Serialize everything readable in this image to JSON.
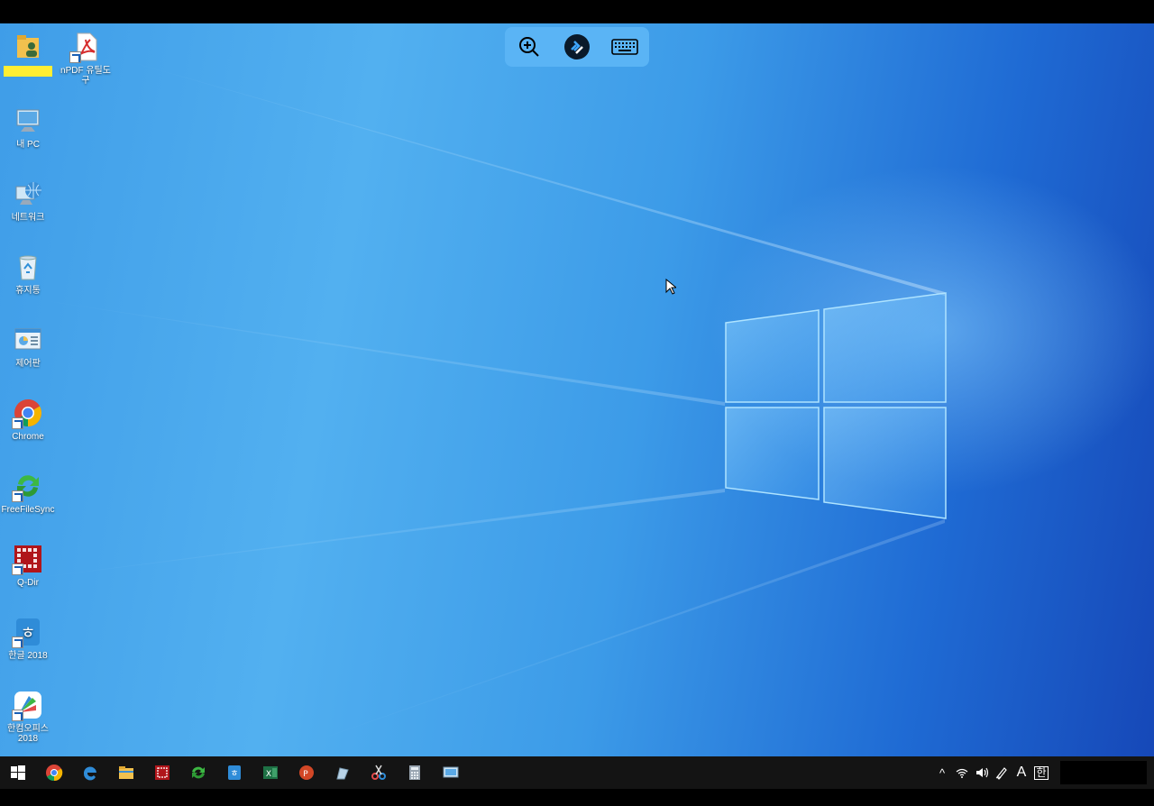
{
  "rdp_toolbar": {
    "zoom_tooltip": "Zoom",
    "connection_tooltip": "Remote Desktop",
    "keyboard_tooltip": "Keyboard"
  },
  "desktop_icons": [
    {
      "name": "user-folder",
      "label": "",
      "icon": "user-folder-icon",
      "highlighted": true
    },
    {
      "name": "npdf",
      "label": "nPDF 유틸도구",
      "icon": "pdf-icon"
    },
    {
      "name": "my-pc",
      "label": "내 PC",
      "icon": "computer-icon"
    },
    {
      "name": "network",
      "label": "네트워크",
      "icon": "network-icon"
    },
    {
      "name": "recycle-bin",
      "label": "휴지통",
      "icon": "recycle-bin-icon"
    },
    {
      "name": "control-panel",
      "label": "제어판",
      "icon": "control-panel-icon"
    },
    {
      "name": "chrome",
      "label": "Chrome",
      "icon": "chrome-icon"
    },
    {
      "name": "freefilesync",
      "label": "FreeFileSync",
      "icon": "sync-icon"
    },
    {
      "name": "q-dir",
      "label": "Q-Dir",
      "icon": "grid-icon"
    },
    {
      "name": "hangul",
      "label": "한글 2018",
      "icon": "hangul-icon"
    },
    {
      "name": "hancom-office",
      "label": "한컴오피스 2018",
      "icon": "hancom-icon"
    }
  ],
  "taskbar": {
    "items": [
      "start-icon",
      "chrome-icon",
      "edge-icon",
      "folder-icon",
      "q-dir-icon",
      "sync-icon",
      "hangul-icon",
      "excel-icon",
      "powerpoint-icon",
      "pen-icon",
      "snipping-icon",
      "calculator-icon",
      "remote-icon"
    ],
    "tray": {
      "chevron": "^",
      "font_indicator": "A",
      "ime_indicator": "한"
    }
  },
  "colors": {
    "desktop_light": "#52b0f0",
    "desktop_dark": "#1648b8",
    "taskbar": "#141414",
    "rdp_bar": "#5ab4f5"
  }
}
